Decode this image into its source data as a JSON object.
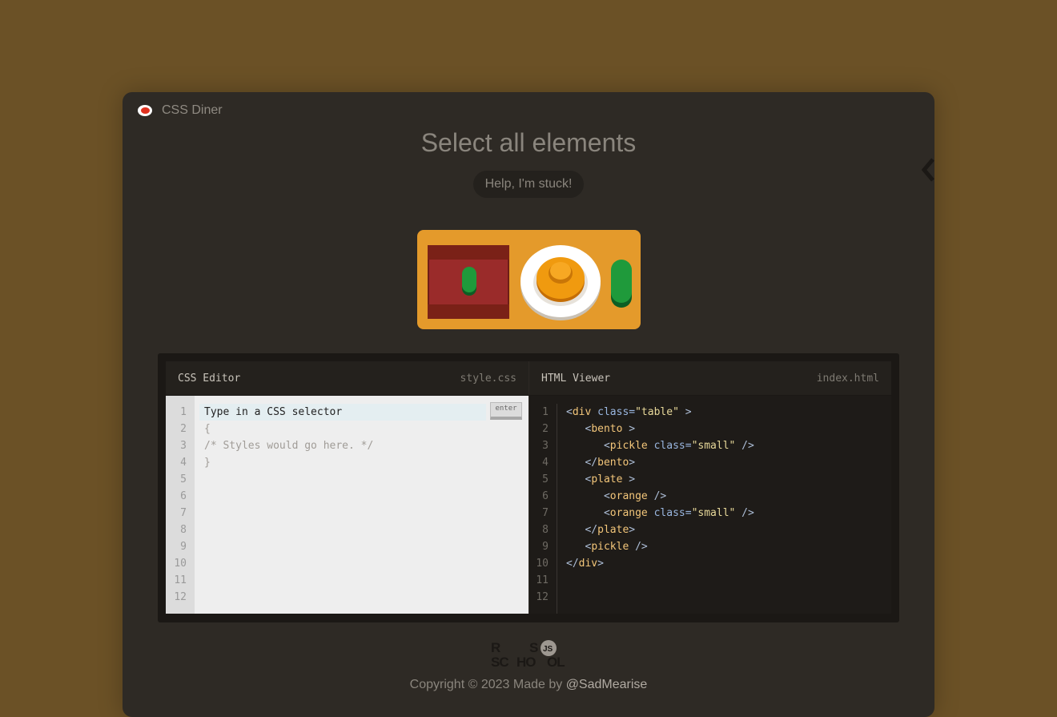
{
  "app": {
    "title": "CSS Diner"
  },
  "level": {
    "title": "Select all elements"
  },
  "help_button": "Help, I'm stuck!",
  "table_items": [
    "bento",
    "pickle-small",
    "plate",
    "orange",
    "orange-small",
    "pickle"
  ],
  "css_editor": {
    "label": "CSS Editor",
    "file": "style.css",
    "placeholder": "Type in a CSS selector",
    "enter_label": "enter",
    "lines": [
      "{",
      "/* Styles would go here. */",
      "}"
    ],
    "line_numbers": [
      "1",
      "2",
      "3",
      "4",
      "5",
      "6",
      "7",
      "8",
      "9",
      "10",
      "11",
      "12"
    ]
  },
  "html_viewer": {
    "label": "HTML Viewer",
    "file": "index.html",
    "line_numbers": [
      "1",
      "2",
      "3",
      "4",
      "5",
      "6",
      "7",
      "8",
      "9",
      "10",
      "11",
      "12"
    ],
    "code": [
      {
        "indent": "",
        "open": "<",
        "tag": "div",
        "attr": " class=",
        "val": "\"table\"",
        "close": " >"
      },
      {
        "indent": "   ",
        "open": "<",
        "tag": "bento",
        "attr": "",
        "val": "",
        "close": " >"
      },
      {
        "indent": "      ",
        "open": "<",
        "tag": "pickle",
        "attr": " class=",
        "val": "\"small\"",
        "close": " />"
      },
      {
        "indent": "   ",
        "open": "</",
        "tag": "bento",
        "attr": "",
        "val": "",
        "close": ">"
      },
      {
        "indent": "   ",
        "open": "<",
        "tag": "plate",
        "attr": "",
        "val": "",
        "close": " >"
      },
      {
        "indent": "      ",
        "open": "<",
        "tag": "orange",
        "attr": "",
        "val": "",
        "close": " />"
      },
      {
        "indent": "      ",
        "open": "<",
        "tag": "orange",
        "attr": " class=",
        "val": "\"small\"",
        "close": " />"
      },
      {
        "indent": "   ",
        "open": "</",
        "tag": "plate",
        "attr": "",
        "val": "",
        "close": ">"
      },
      {
        "indent": "   ",
        "open": "<",
        "tag": "pickle",
        "attr": "",
        "val": "",
        "close": " />"
      },
      {
        "indent": "",
        "open": "</",
        "tag": "div",
        "attr": "",
        "val": "",
        "close": ">"
      }
    ]
  },
  "footer": {
    "logo_text": "RS SCHOOL JS",
    "copyright": "Copyright © 2023 Made by ",
    "author": "@SadMearise"
  },
  "colors": {
    "background": "#6b5126",
    "window": "#2e2a25",
    "table": "#e49a2b",
    "logo_red": "#e0301e"
  }
}
